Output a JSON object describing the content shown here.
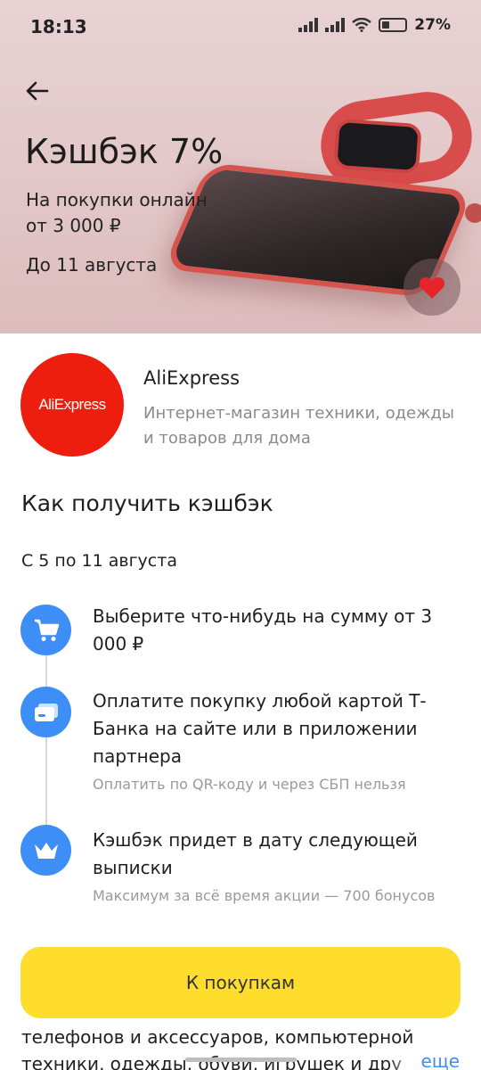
{
  "status_bar": {
    "time": "18:13",
    "battery": "27%"
  },
  "hero": {
    "title": "Кэшбэк 7%",
    "subtitle": "На покупки онлайн от 3 000 ₽",
    "date": "До 11 августа"
  },
  "partner": {
    "logo_text": "AliExpress",
    "name": "AliExpress",
    "description": "Интернет-магазин техники, одежды и товаров для дома"
  },
  "how_to": {
    "title": "Как получить кэшбэк",
    "period": "С 5 по 11 августа",
    "steps": [
      {
        "icon": "cart-icon",
        "text": "Выберите что-нибудь на сумму от 3 000 ₽",
        "note": ""
      },
      {
        "icon": "card-icon",
        "text": "Оплатите покупку любой картой Т-Банка на сайте или в приложении партнера",
        "note": "Оплатить по QR-коду и через СБП нельзя"
      },
      {
        "icon": "crown-icon",
        "text": "Кэшбэк придет в дату следующей выписки",
        "note": "Максимум за всё время акции — 700 бонусов"
      }
    ]
  },
  "description": {
    "partial_line": "телефонов и аксессуаров, компьютерной",
    "partial_line2": "техники, одежды, обуви, игрушек и дру",
    "more_label": "еще"
  },
  "cta": {
    "label": "К покупкам"
  },
  "colors": {
    "accent_yellow": "#ffdd2d",
    "step_blue": "#3d8ef6",
    "logo_red": "#ee1e0f",
    "link_blue": "#3d8ef6"
  }
}
